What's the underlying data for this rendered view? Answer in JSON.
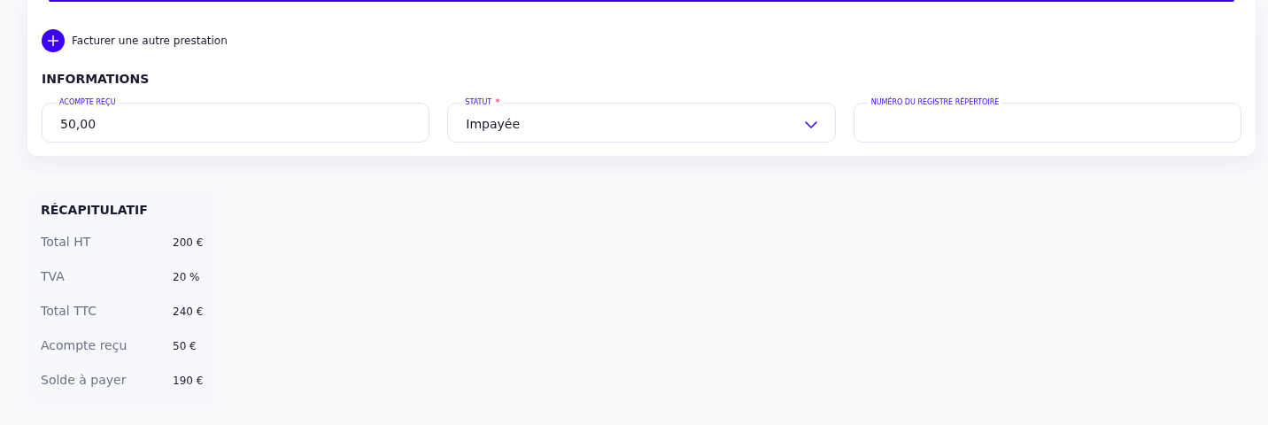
{
  "add_service": {
    "label": "Facturer une autre prestation"
  },
  "informations": {
    "title": "INFORMATIONS",
    "fields": [
      {
        "kind": "input",
        "label": "ACOMPTE REÇU",
        "value": "50,00"
      },
      {
        "kind": "select",
        "label": "STATUT",
        "required_mark": "*",
        "value": "Impayée"
      },
      {
        "kind": "input",
        "label": "NUMÉRO DU REGISTRE RÉPERTOIRE"
      }
    ]
  },
  "summary": {
    "title": "RÉCAPITULATIF",
    "rows": [
      {
        "label": "Total HT",
        "value": "200 €"
      },
      {
        "label": "TVA",
        "value": "20 %"
      },
      {
        "label": "Total TTC",
        "value": "240 €"
      },
      {
        "label": "Acompte reçu",
        "value": "50 €"
      },
      {
        "label": "Solde à payer",
        "value": "190 €"
      }
    ]
  }
}
